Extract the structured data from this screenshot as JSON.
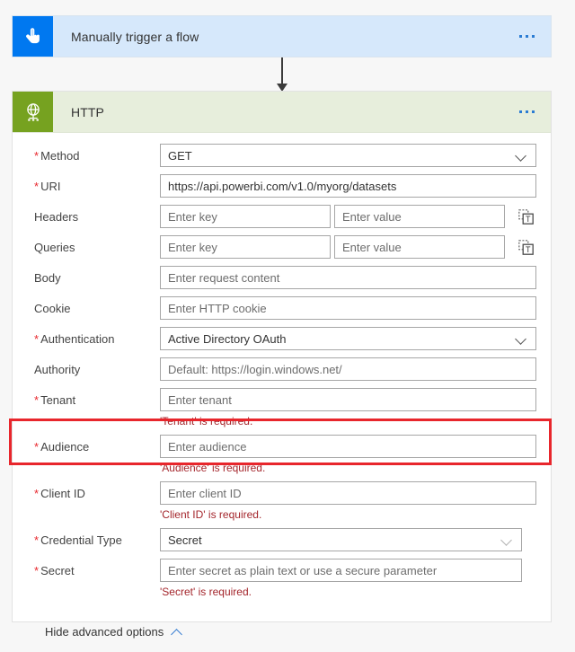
{
  "trigger": {
    "title": "Manually trigger a flow",
    "icon": "tap-hand-icon",
    "menu": "more-commands",
    "accent_color": "#0078F0",
    "body_color": "#D6E8FB"
  },
  "action": {
    "title": "HTTP",
    "icon": "globe-network-icon",
    "menu": "more-commands",
    "accent_color": "#76A220",
    "header_color": "#E7EEDC"
  },
  "colors": {
    "required_asterisk": "#E8262C",
    "error_text": "#A4262C",
    "highlight_border": "#E8262C",
    "link_chevron": "#3A80D2"
  },
  "fields": [
    {
      "label": "Method",
      "required": true,
      "type": "dropdown",
      "value": "GET",
      "placeholder": "",
      "error": ""
    },
    {
      "label": "URI",
      "required": true,
      "type": "text",
      "value": "https://api.powerbi.com/v1.0/myorg/datasets",
      "placeholder": "",
      "error": ""
    },
    {
      "label": "Headers",
      "required": false,
      "type": "keyvalue",
      "key_placeholder": "Enter key",
      "value_placeholder": "Enter value",
      "error": ""
    },
    {
      "label": "Queries",
      "required": false,
      "type": "keyvalue",
      "key_placeholder": "Enter key",
      "value_placeholder": "Enter value",
      "error": ""
    },
    {
      "label": "Body",
      "required": false,
      "type": "text",
      "value": "",
      "placeholder": "Enter request content",
      "error": ""
    },
    {
      "label": "Cookie",
      "required": false,
      "type": "text",
      "value": "",
      "placeholder": "Enter HTTP cookie",
      "error": ""
    },
    {
      "label": "Authentication",
      "required": true,
      "type": "dropdown",
      "value": "Active Directory OAuth",
      "placeholder": "",
      "error": ""
    },
    {
      "label": "Authority",
      "required": false,
      "type": "text",
      "value": "",
      "placeholder": "Default: https://login.windows.net/",
      "error": ""
    },
    {
      "label": "Tenant",
      "required": true,
      "type": "text",
      "value": "",
      "placeholder": "Enter tenant",
      "error": "'Tenant' is required."
    },
    {
      "label": "Audience",
      "required": true,
      "type": "text",
      "value": "",
      "placeholder": "Enter audience",
      "error": "'Audience' is required.",
      "highlighted": true
    },
    {
      "label": "Client ID",
      "required": true,
      "type": "text",
      "value": "",
      "placeholder": "Enter client ID",
      "error": "'Client ID' is required."
    },
    {
      "label": "Credential Type",
      "required": true,
      "type": "dropdown",
      "value": "Secret",
      "placeholder": "",
      "error": ""
    },
    {
      "label": "Secret",
      "required": true,
      "type": "text",
      "value": "",
      "placeholder": "Enter secret as plain text or use a secure parameter",
      "error": "'Secret' is required."
    }
  ],
  "advanced_toggle": {
    "label": "Hide advanced options",
    "icon": "chevron-up-icon"
  }
}
